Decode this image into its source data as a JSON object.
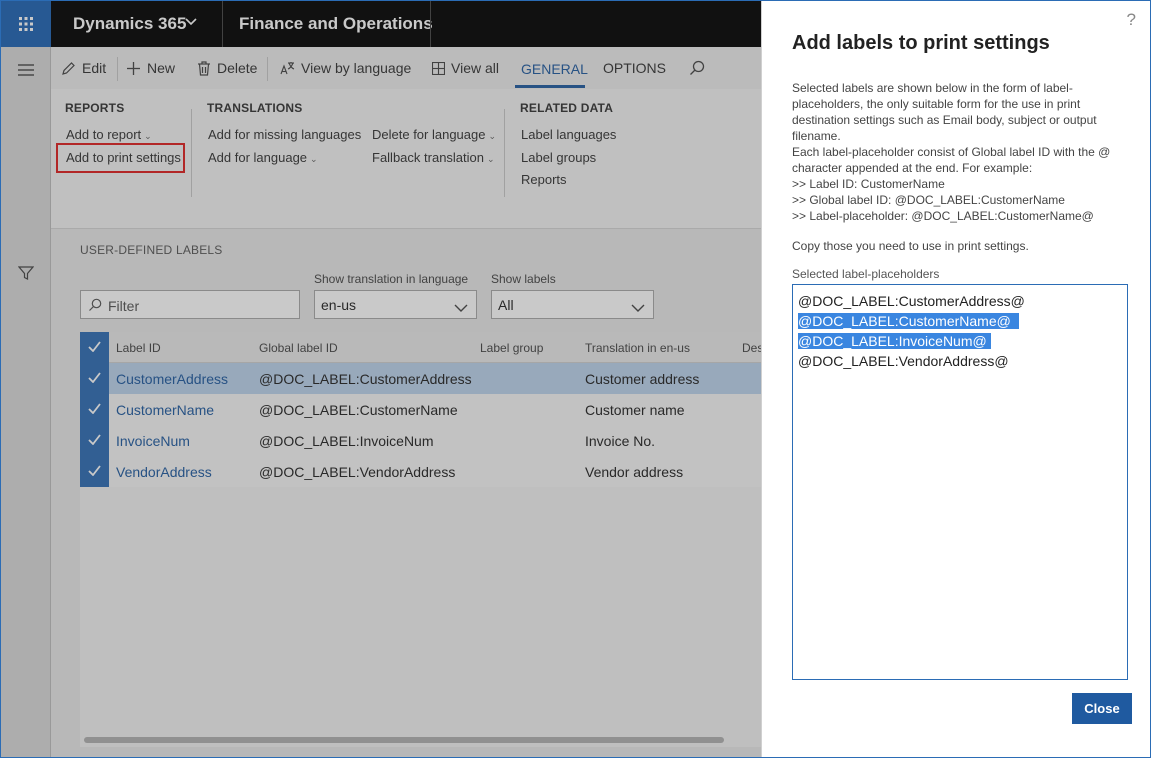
{
  "topbar": {
    "app_title": "Dynamics 365",
    "module_title": "Finance and Operations"
  },
  "actionbar": {
    "edit": "Edit",
    "new": "New",
    "delete": "Delete",
    "view_by_language": "View by language",
    "view_all": "View all",
    "tab_general": "GENERAL",
    "tab_options": "OPTIONS"
  },
  "ribbon": {
    "reports": {
      "header": "REPORTS",
      "add_to_report": "Add to report",
      "add_to_print_settings": "Add to print settings"
    },
    "translations": {
      "header": "TRANSLATIONS",
      "add_missing": "Add for missing languages",
      "add_for_language": "Add for language",
      "delete_for_language": "Delete for language",
      "fallback_translation": "Fallback translation"
    },
    "related": {
      "header": "RELATED DATA",
      "label_languages": "Label languages",
      "label_groups": "Label groups",
      "reports": "Reports"
    }
  },
  "content": {
    "section_title": "USER-DEFINED LABELS",
    "filter_placeholder": "Filter",
    "show_translation_label": "Show translation in language",
    "show_translation_value": "en-us",
    "show_labels_label": "Show labels",
    "show_labels_value": "All"
  },
  "grid": {
    "columns": [
      "Label ID",
      "Global label ID",
      "Label group",
      "Translation in en-us",
      "Des"
    ],
    "rows": [
      {
        "label_id": "CustomerAddress",
        "global_id": "@DOC_LABEL:CustomerAddress",
        "group": "",
        "translation": "Customer address"
      },
      {
        "label_id": "CustomerName",
        "global_id": "@DOC_LABEL:CustomerName",
        "group": "",
        "translation": "Customer name"
      },
      {
        "label_id": "InvoiceNum",
        "global_id": "@DOC_LABEL:InvoiceNum",
        "group": "",
        "translation": "Invoice No."
      },
      {
        "label_id": "VendorAddress",
        "global_id": "@DOC_LABEL:VendorAddress",
        "group": "",
        "translation": "Vendor address"
      }
    ]
  },
  "panel": {
    "help": "?",
    "title": "Add labels to print settings",
    "desc_lines": [
      "Selected labels are shown below in the form of label-",
      "placeholders, the only suitable form for the use in print",
      "destination settings such as Email body, subject or output",
      "filename.",
      "Each label-placeholder consist of Global label ID with the @",
      "character appended at the end. For example:",
      ">> Label ID: CustomerName",
      ">> Global label ID: @DOC_LABEL:CustomerName",
      ">> Label-placeholder: @DOC_LABEL:CustomerName@"
    ],
    "copy_note": "Copy those you need to use in print settings.",
    "textarea_label": "Selected label-placeholders",
    "placeholders": [
      "@DOC_LABEL:CustomerAddress@",
      "@DOC_LABEL:CustomerName@",
      "@DOC_LABEL:InvoiceNum@",
      "@DOC_LABEL:VendorAddress@"
    ],
    "close": "Close"
  },
  "colors": {
    "accent": "#1f5aa0",
    "waffle": "#1f64b4",
    "selection": "#3a86e0",
    "highlight_box": "#e01f1f"
  },
  "icons": [
    "waffle-icon",
    "chevron-down-icon",
    "hamburger-icon",
    "filter-icon",
    "edit-icon",
    "plus-icon",
    "trash-icon",
    "translate-icon",
    "grid-icon",
    "search-icon",
    "checkmark-icon"
  ]
}
